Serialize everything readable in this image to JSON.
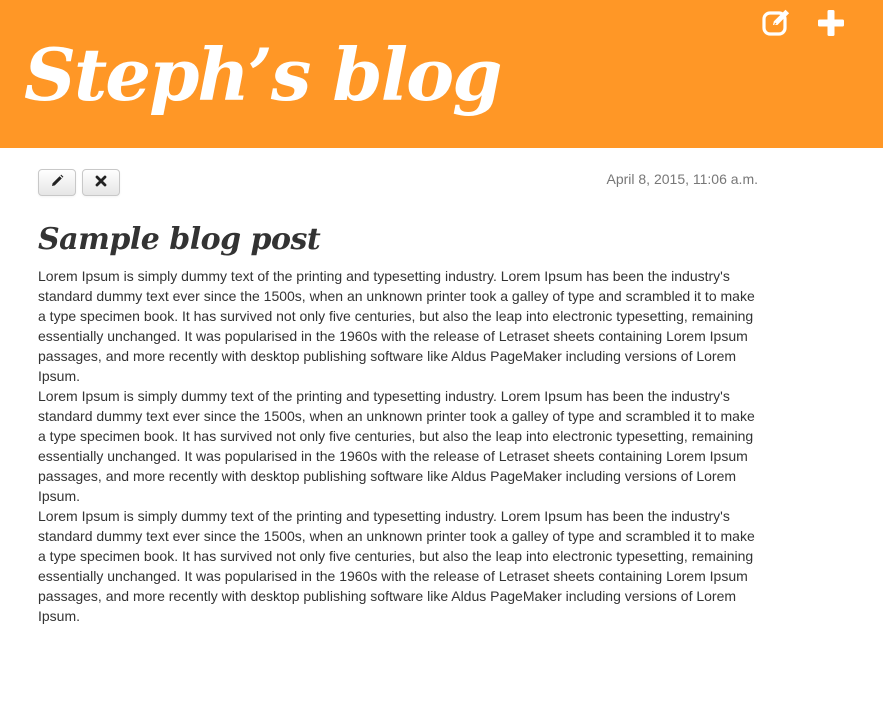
{
  "header": {
    "site_title": "Steph’s blog",
    "icons": [
      "new-post-icon",
      "add-icon"
    ],
    "background_color": "#ff9726"
  },
  "post": {
    "toolbar": {
      "edit_icon": "pencil-icon",
      "delete_icon": "close-icon"
    },
    "date": "April 8, 2015, 11:06 a.m.",
    "title": "Sample blog post",
    "paragraphs": [
      "Lorem Ipsum is simply dummy text of the printing and typesetting industry. Lorem Ipsum has been the industry's standard dummy text ever since the 1500s, when an unknown printer took a galley of type and scrambled it to make a type specimen book. It has survived not only five centuries, but also the leap into electronic typesetting, remaining essentially unchanged. It was popularised in the 1960s with the release of Letraset sheets containing Lorem Ipsum passages, and more recently with desktop publishing software like Aldus PageMaker including versions of Lorem Ipsum.",
      "Lorem Ipsum is simply dummy text of the printing and typesetting industry. Lorem Ipsum has been the industry's standard dummy text ever since the 1500s, when an unknown printer took a galley of type and scrambled it to make a type specimen book. It has survived not only five centuries, but also the leap into electronic typesetting, remaining essentially unchanged. It was popularised in the 1960s with the release of Letraset sheets containing Lorem Ipsum passages, and more recently with desktop publishing software like Aldus PageMaker including versions of Lorem Ipsum.",
      "Lorem Ipsum is simply dummy text of the printing and typesetting industry. Lorem Ipsum has been the industry's standard dummy text ever since the 1500s, when an unknown printer took a galley of type and scrambled it to make a type specimen book. It has survived not only five centuries, but also the leap into electronic typesetting, remaining essentially unchanged. It was popularised in the 1960s with the release of Letraset sheets containing Lorem Ipsum passages, and more recently with desktop publishing software like Aldus PageMaker including versions of Lorem Ipsum."
    ]
  }
}
